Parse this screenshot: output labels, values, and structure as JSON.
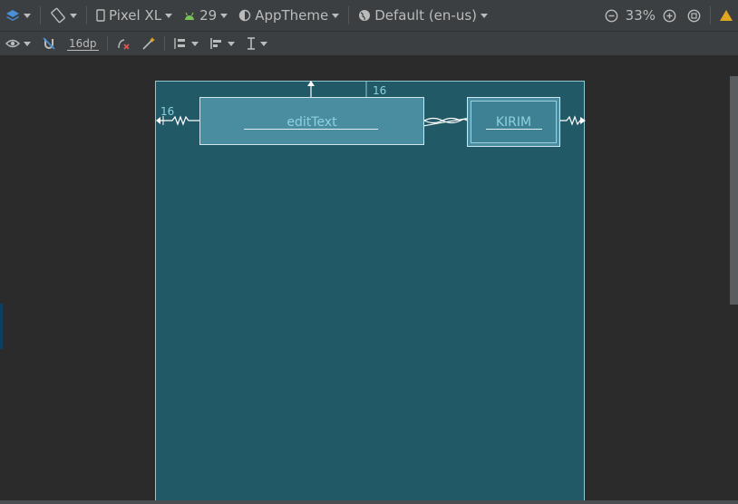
{
  "toolbar": {
    "device": "Pixel XL",
    "api": "29",
    "theme": "AppTheme",
    "locale": "Default (en-us)",
    "zoom": "33%"
  },
  "toolbar2": {
    "margin": "16dp"
  },
  "design": {
    "edit_text_label": "editText",
    "button_label": "KIRIM",
    "top_margin": "16",
    "left_margin": "16"
  },
  "colors": {
    "canvas_bg": "#2b2b2b",
    "device_bg": "#215966",
    "widget_bg": "#4a8da0",
    "android_green": "#78c257",
    "warning": "#e0a61f",
    "accent_blue": "#4a90d9"
  },
  "icons": [
    "layers-icon",
    "rotate-icon",
    "phone-icon",
    "android-icon",
    "theme-icon",
    "globe-icon",
    "zoom-out-icon",
    "zoom-in-icon",
    "zoom-fit-icon",
    "warning-icon",
    "eye-icon",
    "magnet-off-icon",
    "clear-constraints-icon",
    "magic-wand-icon",
    "pack-icon",
    "align-icon",
    "guidelines-icon"
  ]
}
